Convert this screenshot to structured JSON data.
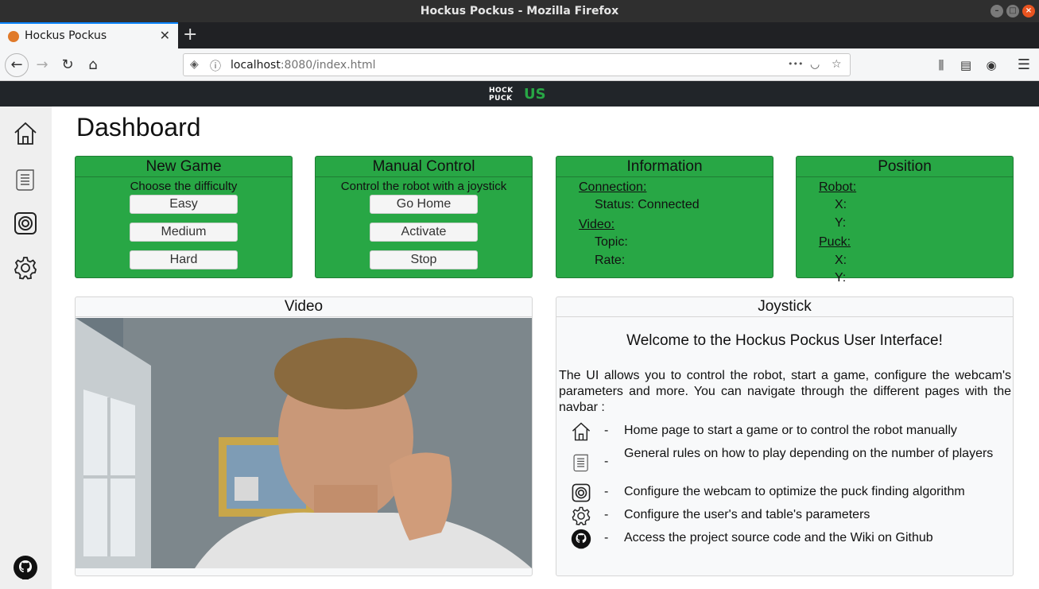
{
  "browser": {
    "window_title": "Hockus Pockus - Mozilla Firefox",
    "tab_title": "Hockus Pockus",
    "url_host": "localhost",
    "url_rest": ":8080/index.html",
    "url_ellipsis": "•••"
  },
  "app": {
    "logo_line1": "HOCK",
    "logo_line2": "PUCK",
    "logo_us": "US",
    "page_title": "Dashboard"
  },
  "cards": {
    "new_game": {
      "title": "New Game",
      "subtitle": "Choose the difficulty",
      "buttons": [
        "Easy",
        "Medium",
        "Hard"
      ]
    },
    "manual_control": {
      "title": "Manual Control",
      "subtitle": "Control the robot with a joystick",
      "buttons": [
        "Go Home",
        "Activate",
        "Stop"
      ]
    },
    "information": {
      "title": "Information",
      "connection_label": "Connection:",
      "status_line": "Status: Connected",
      "video_label": "Video:",
      "topic_line": "Topic:",
      "rate_line": "Rate:"
    },
    "position": {
      "title": "Position",
      "robot_label": "Robot:",
      "robot_x": "X:",
      "robot_y": "Y:",
      "puck_label": "Puck:",
      "puck_x": "X:",
      "puck_y": "Y:"
    }
  },
  "video_panel": {
    "title": "Video"
  },
  "joystick_panel": {
    "title": "Joystick",
    "welcome": "Welcome to the Hockus Pockus User Interface!",
    "intro": "The UI allows you to control the robot, start a game, configure the webcam's parameters and more. You can navigate through the different pages with the navbar :",
    "legend": [
      {
        "icon": "home-icon",
        "dash": "-",
        "text": "Home page to start a game or to control the robot manually"
      },
      {
        "icon": "rules-icon",
        "dash": "-",
        "text": "General rules on how to play depending on the number of players"
      },
      {
        "icon": "webcam-icon",
        "dash": "-",
        "text": "Configure the webcam to optimize the puck finding algorithm"
      },
      {
        "icon": "gear-icon",
        "dash": "-",
        "text": "Configure the user's and table's parameters"
      },
      {
        "icon": "github-icon",
        "dash": "-",
        "text": "Access the project source code and the Wiki on Github"
      }
    ]
  },
  "sidebar": {
    "items": [
      "home-icon",
      "rules-icon",
      "webcam-icon",
      "gear-icon",
      "github-icon"
    ]
  },
  "colors": {
    "card_green": "#28a745",
    "header_dark": "#212529",
    "sidebar_bg": "#efefef"
  }
}
